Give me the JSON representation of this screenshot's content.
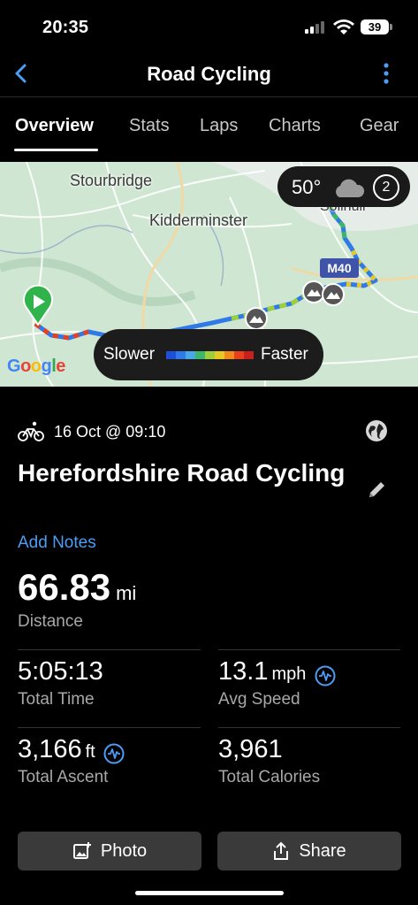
{
  "status": {
    "time": "20:35",
    "battery": "39"
  },
  "nav": {
    "title": "Road Cycling"
  },
  "tabs": [
    "Overview",
    "Stats",
    "Laps",
    "Charts",
    "Gear"
  ],
  "map": {
    "places": [
      "Stourbridge",
      "Kidderminster",
      "Solihull"
    ],
    "road_label": "M40",
    "weather": {
      "temp": "50°",
      "badge": "2"
    },
    "legend": {
      "slower": "Slower",
      "faster": "Faster",
      "colors": [
        "#1e4fd6",
        "#2f7ae8",
        "#4aa8e8",
        "#3fb56a",
        "#9ccf3a",
        "#e8c825",
        "#f08a1c",
        "#e8401c",
        "#c8201c"
      ]
    },
    "attribution": "Google"
  },
  "activity": {
    "date": "16 Oct @ 09:10",
    "name": "Herefordshire Road Cycling",
    "add_notes": "Add Notes",
    "distance": {
      "value": "66.83",
      "unit": "mi",
      "label": "Distance"
    }
  },
  "stats": [
    {
      "value": "5:05:13",
      "unit": "",
      "label": "Total Time"
    },
    {
      "value": "13.1",
      "unit": "mph",
      "label": "Avg Speed"
    },
    {
      "value": "3,166",
      "unit": "ft",
      "label": "Total Ascent"
    },
    {
      "value": "3,961",
      "unit": "",
      "label": "Total Calories"
    }
  ],
  "buttons": {
    "photo": "Photo",
    "share": "Share"
  },
  "colors": {
    "accent": "#4b9df5",
    "background": "#000000"
  }
}
